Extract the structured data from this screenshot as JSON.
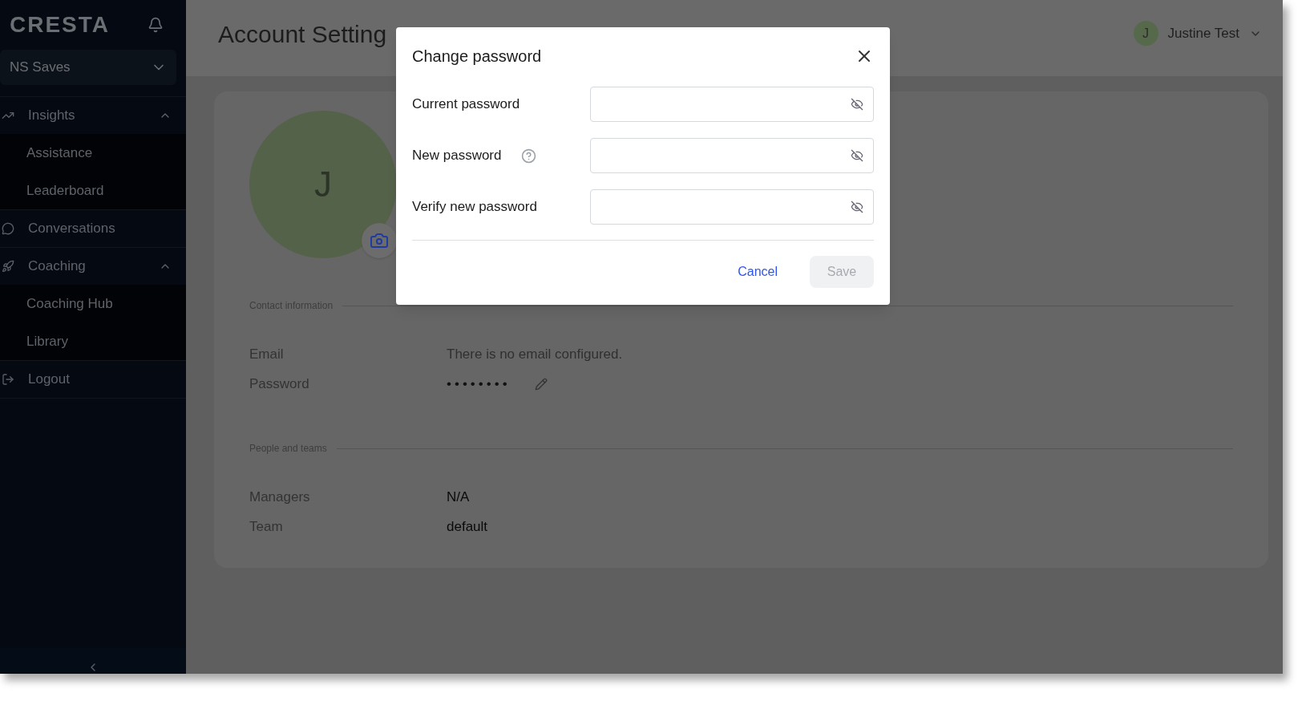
{
  "sidebar": {
    "logo": "CRESTA",
    "workspace": "NS Saves",
    "nav": [
      {
        "label": "Insights",
        "expanded": true,
        "children": [
          {
            "label": "Assistance"
          },
          {
            "label": "Leaderboard"
          }
        ]
      },
      {
        "label": "Conversations"
      },
      {
        "label": "Coaching",
        "expanded": true,
        "children": [
          {
            "label": "Coaching Hub"
          },
          {
            "label": "Library"
          }
        ]
      },
      {
        "label": "Logout"
      }
    ]
  },
  "header": {
    "title": "Account Setting",
    "user": {
      "initial": "J",
      "name": "Justine Test"
    }
  },
  "profile": {
    "avatar_initial": "J",
    "sections": [
      {
        "title": "Contact information",
        "rows": [
          {
            "label": "Email",
            "value": "There is no email configured.",
            "kind": "muted"
          },
          {
            "label": "Password",
            "value": "••••••••",
            "kind": "password"
          }
        ]
      },
      {
        "title": "People and teams",
        "rows": [
          {
            "label": "Managers",
            "value": "N/A",
            "kind": "text"
          },
          {
            "label": "Team",
            "value": "default",
            "kind": "text"
          }
        ]
      }
    ]
  },
  "dialog": {
    "title": "Change password",
    "fields": [
      {
        "label": "Current password",
        "help": false
      },
      {
        "label": "New password",
        "help": true
      },
      {
        "label": "Verify new password",
        "help": false
      }
    ],
    "buttons": [
      {
        "label": "Cancel",
        "kind": "link",
        "disabled": false
      },
      {
        "label": "Save",
        "kind": "primary",
        "disabled": true
      }
    ]
  }
}
